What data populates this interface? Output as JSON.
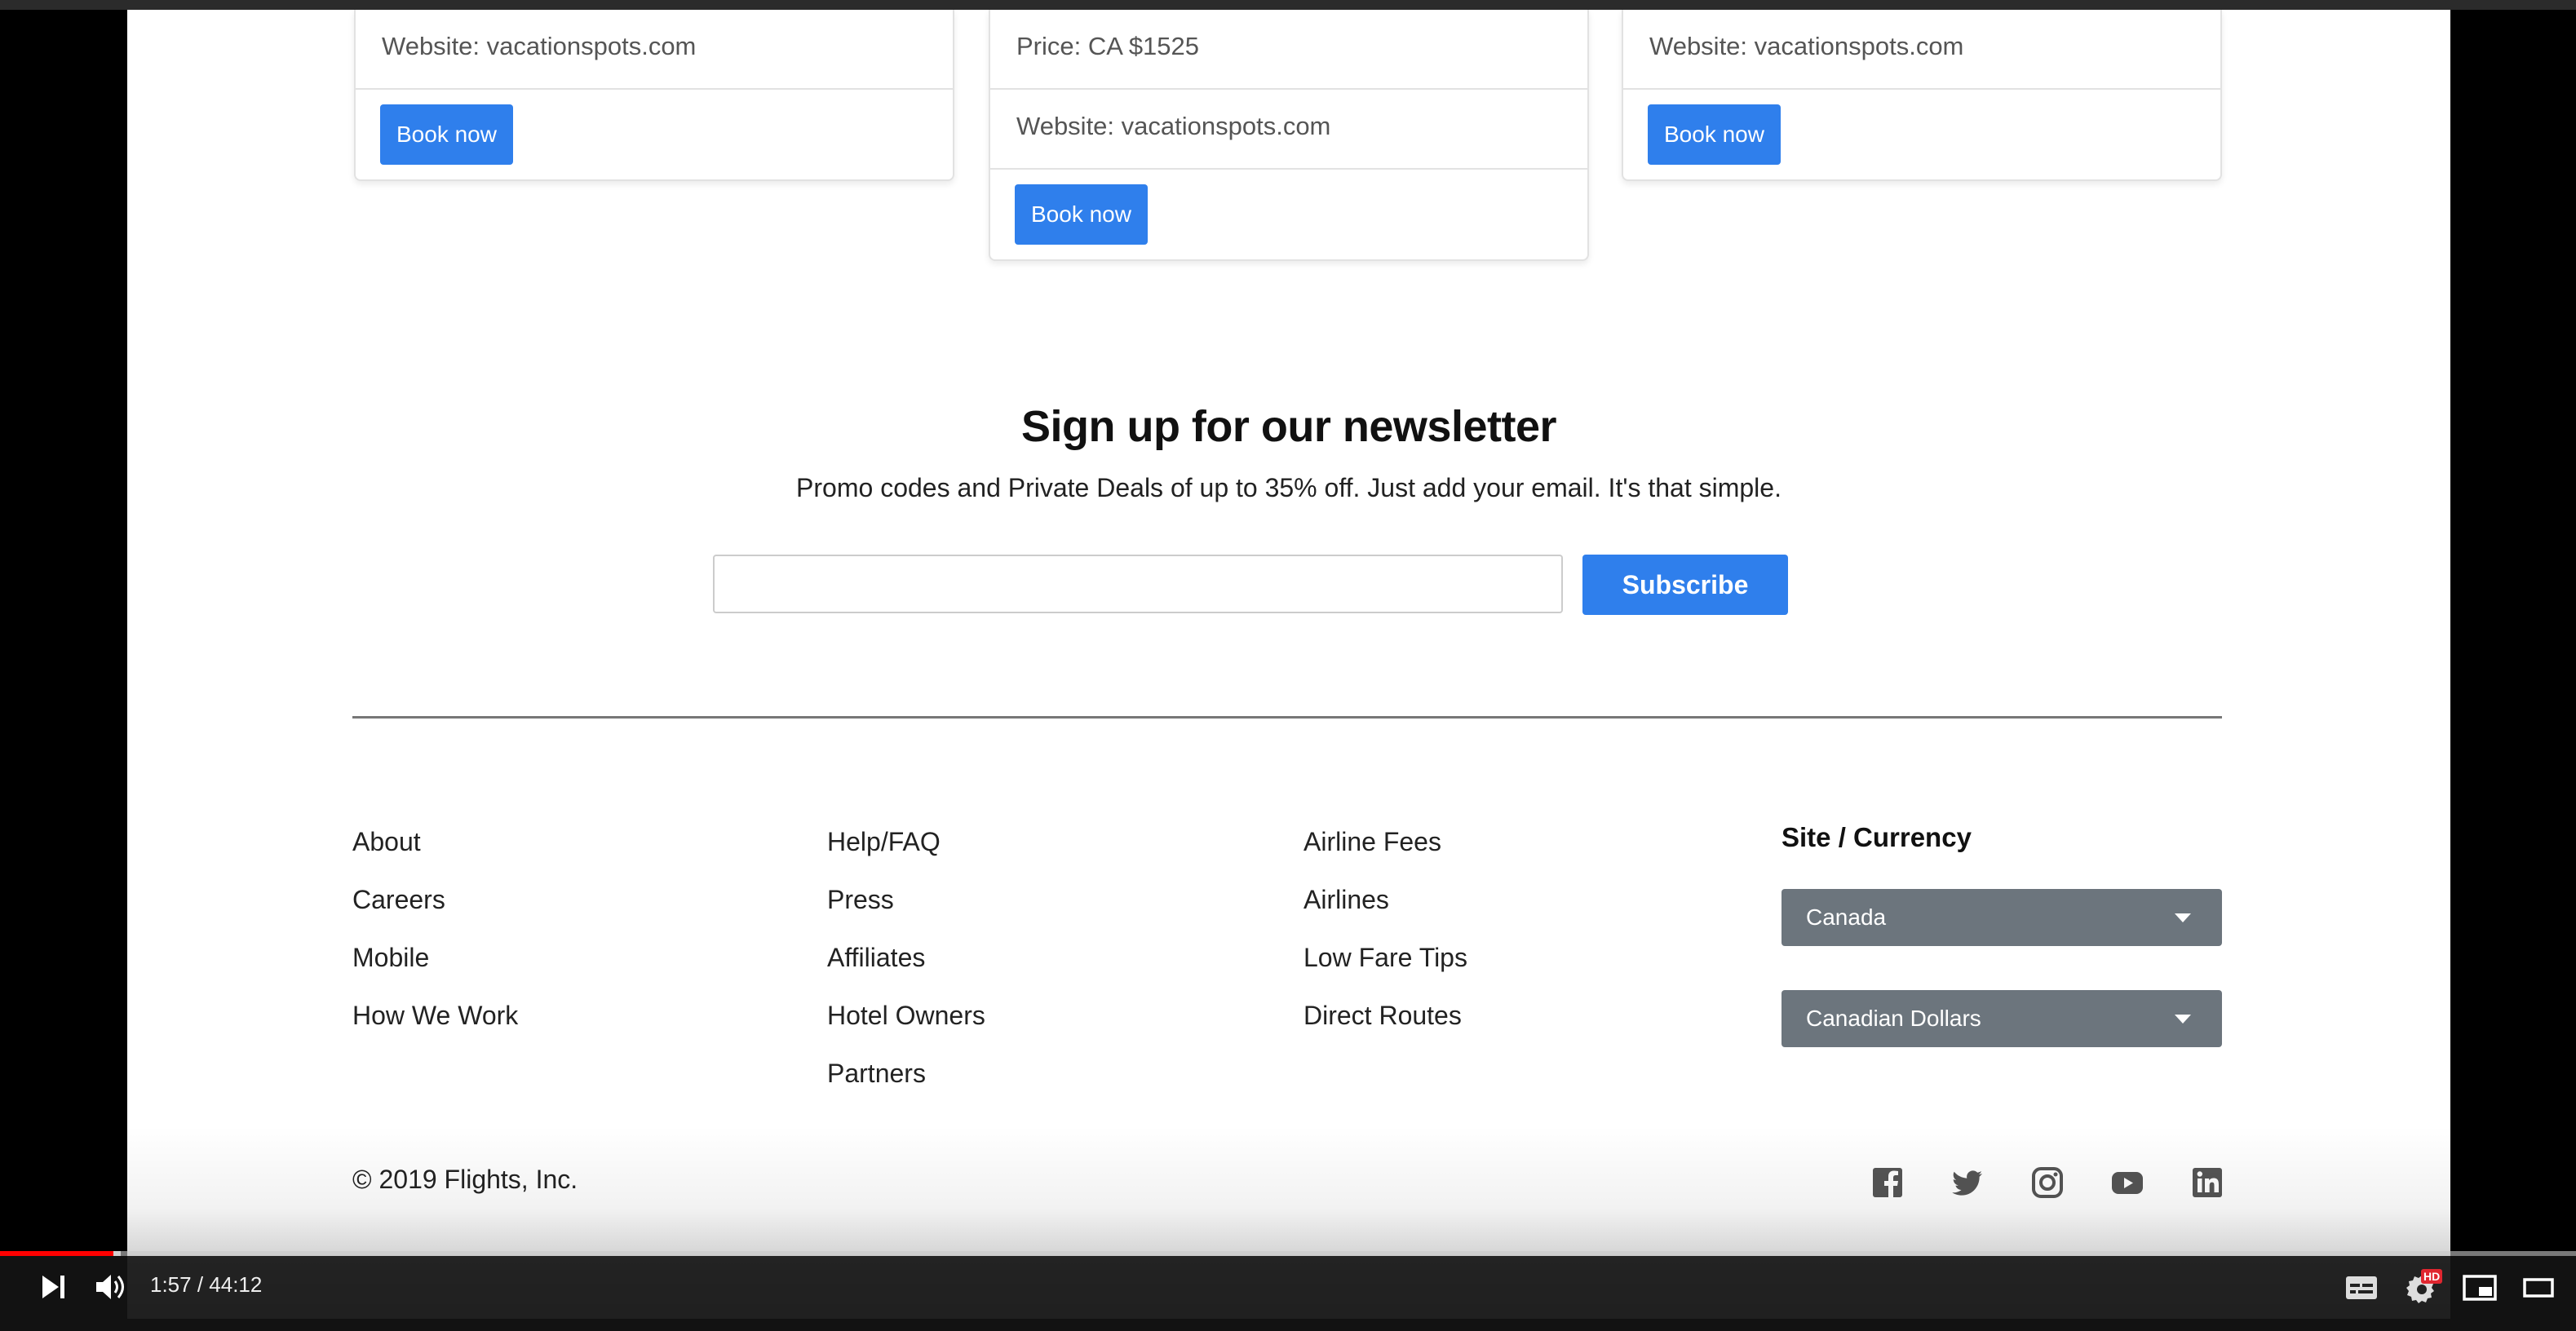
{
  "cards": [
    {
      "rows": [
        "Website: vacationspots.com"
      ],
      "button": "Book now"
    },
    {
      "rows": [
        "Price: CA $1525",
        "Website: vacationspots.com"
      ],
      "button": "Book now"
    },
    {
      "rows": [
        "Website: vacationspots.com"
      ],
      "button": "Book now"
    }
  ],
  "newsletter": {
    "title": "Sign up for our newsletter",
    "subtitle": "Promo codes and Private Deals of up to 35% off. Just add your email. It's that simple.",
    "email_value": "",
    "subscribe_label": "Subscribe"
  },
  "footer": {
    "col1": [
      "About",
      "Careers",
      "Mobile",
      "How We Work"
    ],
    "col2": [
      "Help/FAQ",
      "Press",
      "Affiliates",
      "Hotel Owners",
      "Partners"
    ],
    "col3": [
      "Airline Fees",
      "Airlines",
      "Low Fare Tips",
      "Direct Routes"
    ],
    "site_currency_heading": "Site / Currency",
    "site_selected": "Canada",
    "currency_selected": "Canadian Dollars",
    "copyright": "© 2019 Flights, Inc.",
    "social_icons": [
      "facebook-icon",
      "twitter-icon",
      "instagram-icon",
      "youtube-icon",
      "linkedin-icon"
    ]
  },
  "player": {
    "current_time": "1:57",
    "separator": " / ",
    "duration": "44:12",
    "progress_fraction": 0.044,
    "buffered_fraction": 0.047,
    "hd_badge": "HD",
    "icons": [
      "play-next-icon",
      "volume-icon",
      "subtitles-icon",
      "settings-icon",
      "miniplayer-icon",
      "theater-mode-icon"
    ]
  },
  "colors": {
    "accent": "#2f7fec",
    "select_bg": "#6c757d",
    "progress": "#ff0000"
  }
}
